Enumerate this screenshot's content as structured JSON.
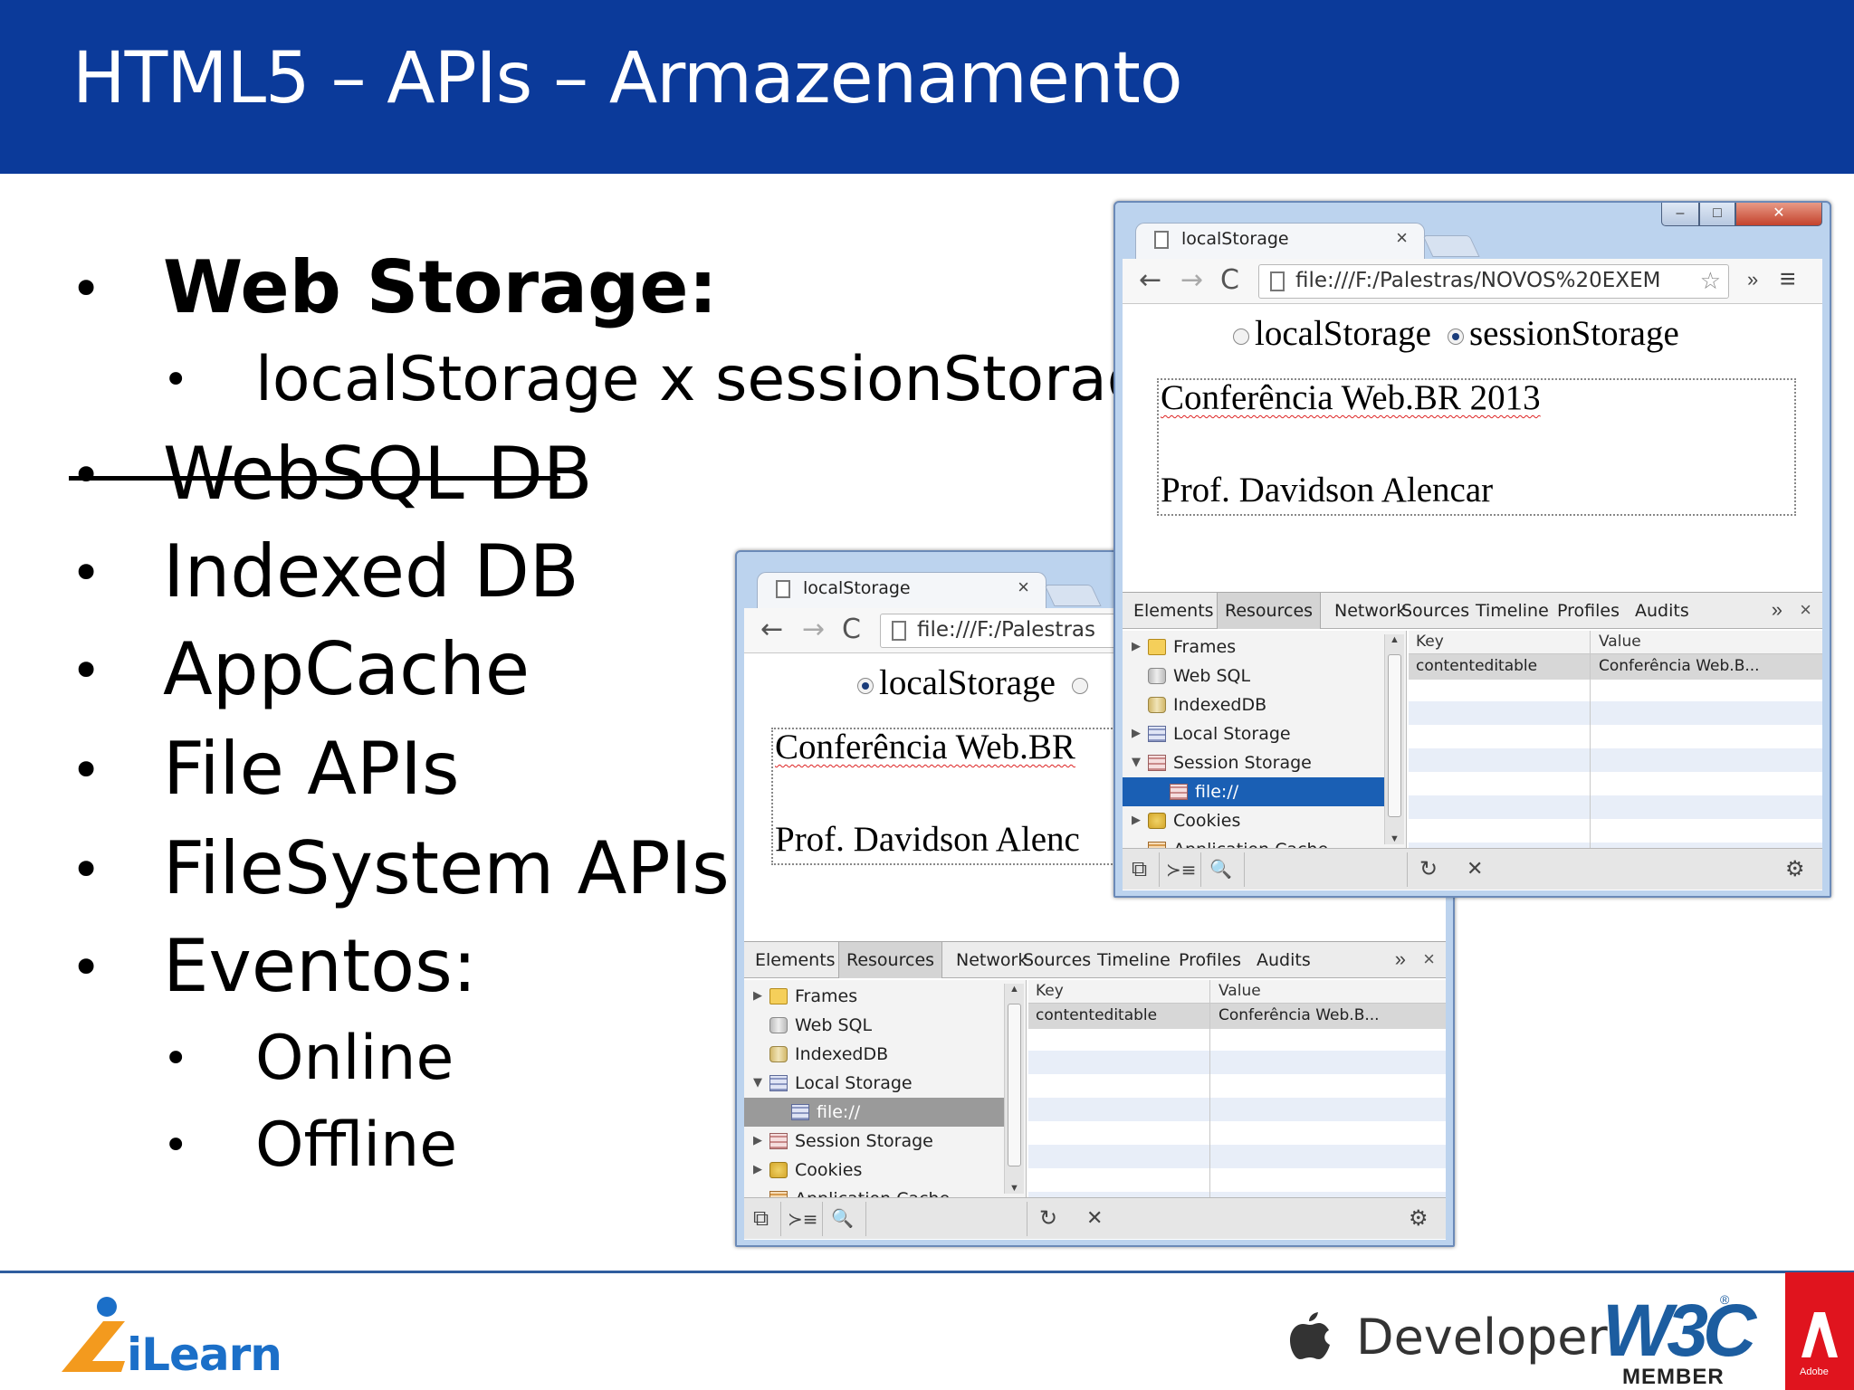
{
  "slide": {
    "title": "HTML5 – APIs – Armazenamento",
    "bullets": [
      {
        "text": "Web Storage:"
      },
      {
        "text": "localStorage x sessionStorage"
      },
      {
        "text": "WebSQL DB"
      },
      {
        "text": "Indexed DB"
      },
      {
        "text": "AppCache"
      },
      {
        "text": "File APIs"
      },
      {
        "text": "FileSystem APIs"
      },
      {
        "text": "Eventos:"
      },
      {
        "text": "Online"
      },
      {
        "text": "Offline"
      }
    ],
    "bullet_glyph": "•"
  },
  "windows": {
    "back": {
      "tab_title": "localStorage",
      "url": "file:///F:/Palestras",
      "radio_local": "localStorage",
      "radio_local_checked": true,
      "editable_line1": "Conferência Web.BR",
      "editable_line2": "Prof. Davidson Alenc"
    },
    "front": {
      "tab_title": "localStorage",
      "url": "file:///F:/Palestras/NOVOS%20EXEM",
      "radio_local": "localStorage",
      "radio_session": "sessionStorage",
      "radio_session_checked": true,
      "editable_line1": "Conferência Web.BR 2013",
      "editable_line2": "Prof. Davidson Alencar"
    },
    "nav": {
      "back": "←",
      "forward": "→",
      "reload": "C",
      "star": "☆",
      "more": "»",
      "menu": "≡",
      "tab_close": "×"
    },
    "window_controls": {
      "minimize": "–",
      "maximize": "□",
      "close": "✕"
    }
  },
  "devtools": {
    "tabs": [
      "Elements",
      "Resources",
      "Network",
      "Sources",
      "Timeline",
      "Profiles",
      "Audits"
    ],
    "active_tab": "Resources",
    "more": "»",
    "close": "×",
    "tree": {
      "frames": "Frames",
      "websql": "Web SQL",
      "indexeddb": "IndexedDB",
      "local_storage": "Local Storage",
      "session_storage": "Session Storage",
      "origin": "file://",
      "cookies": "Cookies",
      "app_cache": "Application Cache"
    },
    "table": {
      "key_header": "Key",
      "value_header": "Value",
      "rows": [
        {
          "key": "contenteditable",
          "value": "Conferência Web.B..."
        }
      ]
    },
    "status": {
      "dock": "⧉",
      "console": "≻≡",
      "search": "🔍",
      "refresh": "↻",
      "delete": "✕",
      "settings": "⚙"
    }
  },
  "footer": {
    "ilearn": "iLearn",
    "developer": "Developer",
    "w3c": "W3C",
    "w3c_reg": "®",
    "w3c_member": "MEMBER",
    "adobe_small": "Adobe",
    "colors": {
      "header_blue": "#0b3a9a",
      "ilearn_orange": "#f39a1e",
      "ilearn_blue": "#1b6fc8",
      "adobe_red": "#e0141e"
    }
  }
}
